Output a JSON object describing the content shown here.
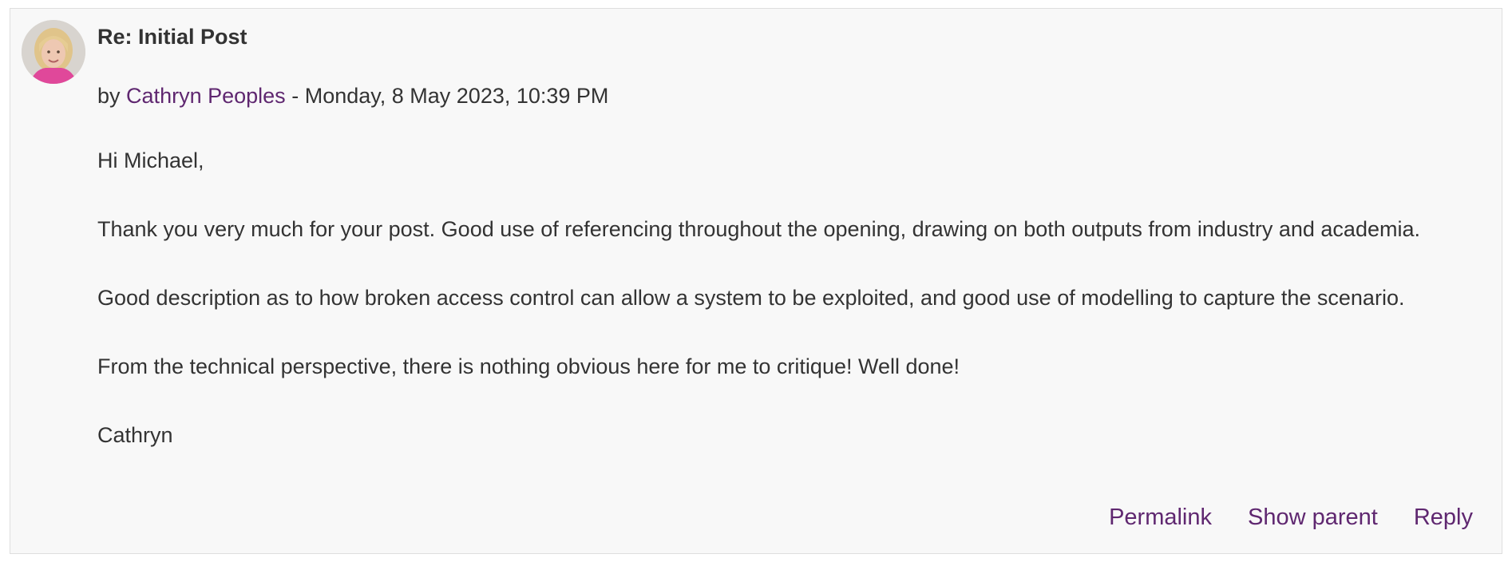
{
  "post": {
    "subject": "Re: Initial Post",
    "by_prefix": "by",
    "author": "Cathryn Peoples",
    "separator": "-",
    "timestamp": "Monday, 8 May 2023, 10:39 PM",
    "paragraphs": [
      "Hi Michael,",
      "Thank you very much for your post. Good use of referencing throughout the opening, drawing on both outputs from industry and academia.",
      "Good description as to how broken access control can allow a system to be exploited, and good use of modelling to capture the scenario.",
      "From the technical perspective, there is nothing obvious here for me to critique! Well done!",
      "Cathryn"
    ],
    "actions": {
      "permalink": "Permalink",
      "show_parent": "Show parent",
      "reply": "Reply"
    }
  },
  "colors": {
    "link": "#5f2770",
    "text": "#333333",
    "background": "#f8f8f8",
    "border": "#dedede"
  }
}
